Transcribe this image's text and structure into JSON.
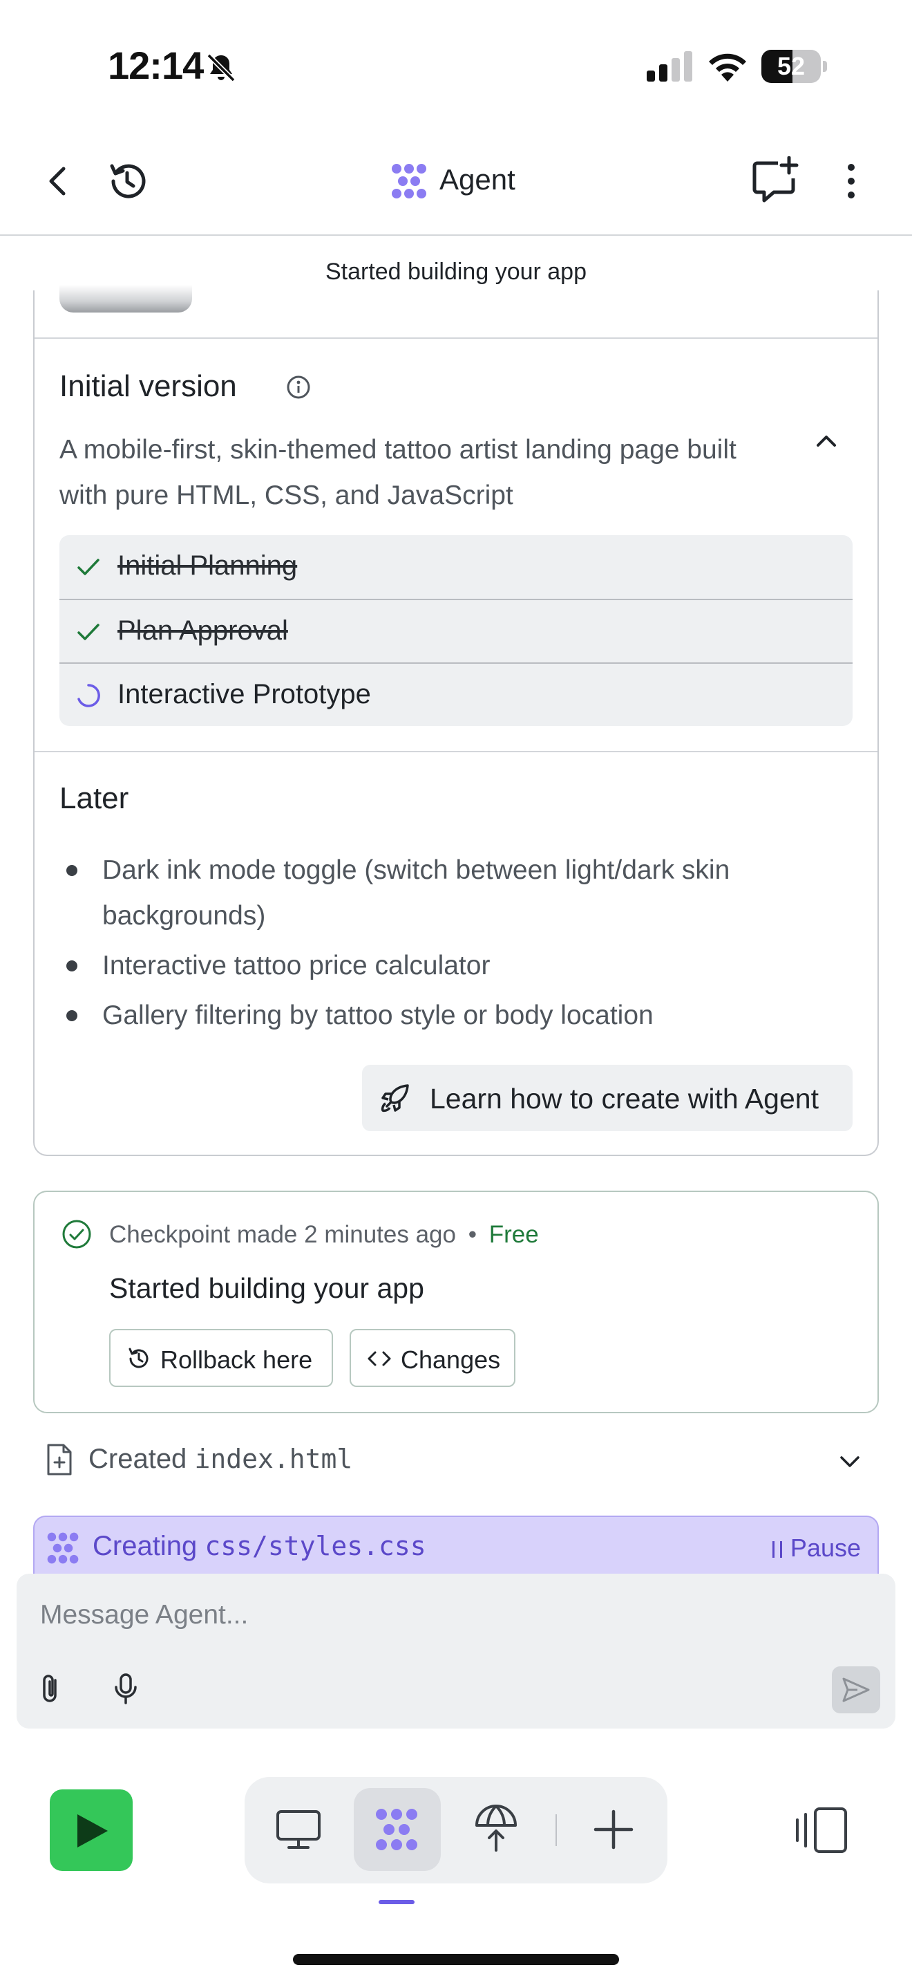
{
  "status_bar": {
    "time": "12:14",
    "battery_percent": 52,
    "battery_label": "52"
  },
  "header": {
    "title": "Agent",
    "icons": [
      "back-icon",
      "history-icon",
      "agent-logo-icon",
      "new-chat-icon",
      "more-vertical-icon"
    ]
  },
  "banner": {
    "text": "Started building your app"
  },
  "plan": {
    "title": "Initial version",
    "description": "A mobile-first, skin-themed tattoo artist landing page built with pure HTML, CSS, and JavaScript",
    "tasks": [
      {
        "label": "Initial Planning",
        "status": "done"
      },
      {
        "label": "Plan Approval",
        "status": "done"
      },
      {
        "label": "Interactive Prototype",
        "status": "in-progress"
      }
    ],
    "later_title": "Later",
    "later_items": [
      "Dark ink mode toggle (switch between light/dark skin backgrounds)",
      "Interactive tattoo price calculator",
      "Gallery filtering by tattoo style or body location"
    ],
    "learn_button": "Learn how to create with Agent"
  },
  "checkpoint": {
    "label": "Checkpoint made",
    "time": "2 minutes ago",
    "separator": "•",
    "price": "Free",
    "title": "Started building your app",
    "rollback_button": "Rollback here",
    "changes_button": "Changes"
  },
  "created": {
    "prefix": "Created",
    "file": "index.html"
  },
  "creating": {
    "prefix": "Creating",
    "file": "css/styles.css",
    "pause_label": "Pause"
  },
  "input": {
    "placeholder": "Message Agent..."
  },
  "colors": {
    "accent": "#6b5ce7",
    "run_green": "#34c759",
    "free_green": "#1f7a3a",
    "creating_bg": "#d8d2fb"
  }
}
